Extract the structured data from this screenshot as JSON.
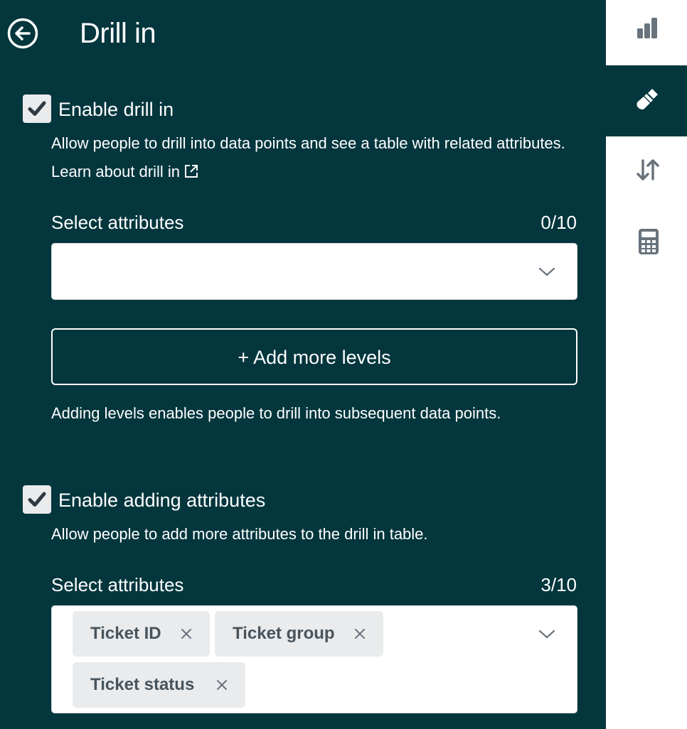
{
  "header": {
    "title": "Drill in",
    "back_icon": "arrow-left-circle-icon"
  },
  "drill_in": {
    "checkbox_label": "Enable drill in",
    "checked": true,
    "description": "Allow people to drill into data points and see a table with related attributes.",
    "learn_link": "Learn about drill in",
    "select_label": "Select attributes",
    "select_count": "0/10",
    "selected_attributes": [],
    "add_levels_label": "+ Add more levels",
    "levels_hint": "Adding levels enables people to drill into subsequent data points."
  },
  "adding_attributes": {
    "checkbox_label": "Enable adding attributes",
    "checked": true,
    "description": "Allow people to add more attributes to the drill in table.",
    "select_label": "Select attributes",
    "select_count": "3/10",
    "selected_attributes": [
      "Ticket ID",
      "Ticket group",
      "Ticket status"
    ]
  },
  "toolbar": {
    "items": [
      {
        "icon": "bar-chart-icon",
        "active": false
      },
      {
        "icon": "paintbrush-icon",
        "active": true
      },
      {
        "icon": "sort-arrows-icon",
        "active": false
      },
      {
        "icon": "calculator-icon",
        "active": false
      }
    ]
  },
  "colors": {
    "panel_background": "#03363d",
    "tag_background": "#e9ebed",
    "tag_text": "#49545c",
    "checkmark": "#2f3941",
    "toolbar_icon": "#68737d"
  }
}
